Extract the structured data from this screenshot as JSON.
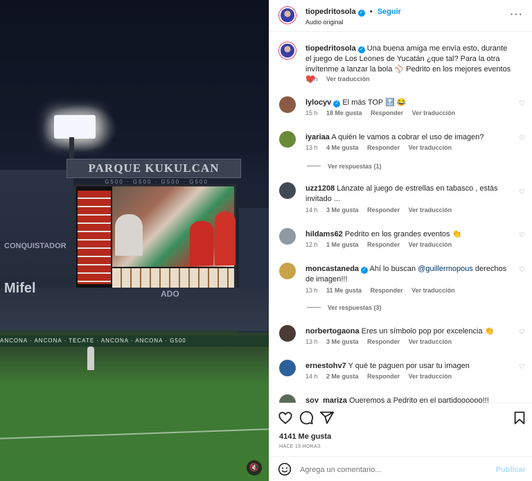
{
  "media": {
    "stadium_sign": "PARQUE KUKULCAN ALAMO",
    "sponsor_text": "G500 · G500 · G500 · G500",
    "wall_left": "CONQUISTADOR",
    "wall_brand": "Mifel",
    "wall_mid": "ADO",
    "ads": "ANCONA · ANCONA · TECATE · ANCONA · ANCONA · G500",
    "mute_icon": "speaker-muted-icon"
  },
  "header": {
    "username": "tiopedritosola",
    "verified": "✓",
    "separator": "•",
    "follow_label": "Seguir",
    "audio": "Audio original",
    "more": "···"
  },
  "caption": {
    "username": "tiopedritosola",
    "verified": "✓",
    "text": "Una buena amiga me envía esto, durante el juego de Los Leones de Yucatán ¿que tal? Para la otra invítenme a lanzar la bola ⚾ Pedrito en los mejores eventos ❤️",
    "time": "15 h",
    "translate": "Ver traducción"
  },
  "comments": [
    {
      "username": "lylocyv",
      "verified": "✓",
      "text": "El más TOP 🔝 😂",
      "time": "15 h",
      "likes": "18 Me gusta",
      "reply": "Responder",
      "translate": "Ver traducción",
      "avatar_color": "#8a5a44"
    },
    {
      "username": "iyariaa",
      "verified": "",
      "text": "A quién le vamos a cobrar el uso de imagen?",
      "time": "13 h",
      "likes": "4 Me gusta",
      "reply": "Responder",
      "translate": "Ver traducción",
      "avatar_color": "#6a8a3a",
      "replies": "Ver respuestas (1)"
    },
    {
      "username": "uzz1208",
      "verified": "",
      "text": "Lánzate al juego de estrellas en tabasco , estás invitado ...",
      "time": "14 h",
      "likes": "3 Me gusta",
      "reply": "Responder",
      "translate": "Ver traducción",
      "avatar_color": "#3f4a55"
    },
    {
      "username": "hildams62",
      "verified": "",
      "text": "Pedrito en los grandes eventos 👏",
      "time": "12 h",
      "likes": "1 Me gusta",
      "reply": "Responder",
      "translate": "Ver traducción",
      "avatar_color": "#8d9aa4"
    },
    {
      "username": "moncastaneda",
      "verified": "✓",
      "text_before": "Ahí lo buscan ",
      "mention": "@guillermopous",
      "text_after": " derechos de imagen!!!",
      "time": "13 h",
      "likes": "11 Me gusta",
      "reply": "Responder",
      "translate": "Ver traducción",
      "avatar_color": "#c9a24a",
      "replies": "Ver respuestas (3)"
    },
    {
      "username": "norbertogaona",
      "verified": "",
      "text": "Eres un símbolo pop por excelencia 👏",
      "time": "13 h",
      "likes": "3 Me gusta",
      "reply": "Responder",
      "translate": "Ver traducción",
      "avatar_color": "#4a3a34"
    },
    {
      "username": "ernestohv7",
      "verified": "",
      "text": "Y qué te paguen por usar tu imagen",
      "time": "14 h",
      "likes": "2 Me gusta",
      "reply": "Responder",
      "translate": "Ver traducción",
      "avatar_color": "#2d5f9a"
    },
    {
      "username": "soy_mariza",
      "verified": "",
      "text": "Queremos a Pedrito en el partidoooooo!!!",
      "time": "",
      "likes": "",
      "reply": "",
      "translate": "",
      "avatar_color": "#5a6a5a"
    }
  ],
  "actions": {
    "like_icon": "heart-icon",
    "comment_icon": "comment-bubble-icon",
    "share_icon": "paper-plane-icon",
    "save_icon": "bookmark-icon",
    "likes_count": "4141 Me gusta",
    "posted_ago": "HACE 15 HORAS"
  },
  "comment_bar": {
    "emoji_icon": "emoji-icon",
    "placeholder": "Agrega un comentario...",
    "publish_label": "Publicar"
  }
}
